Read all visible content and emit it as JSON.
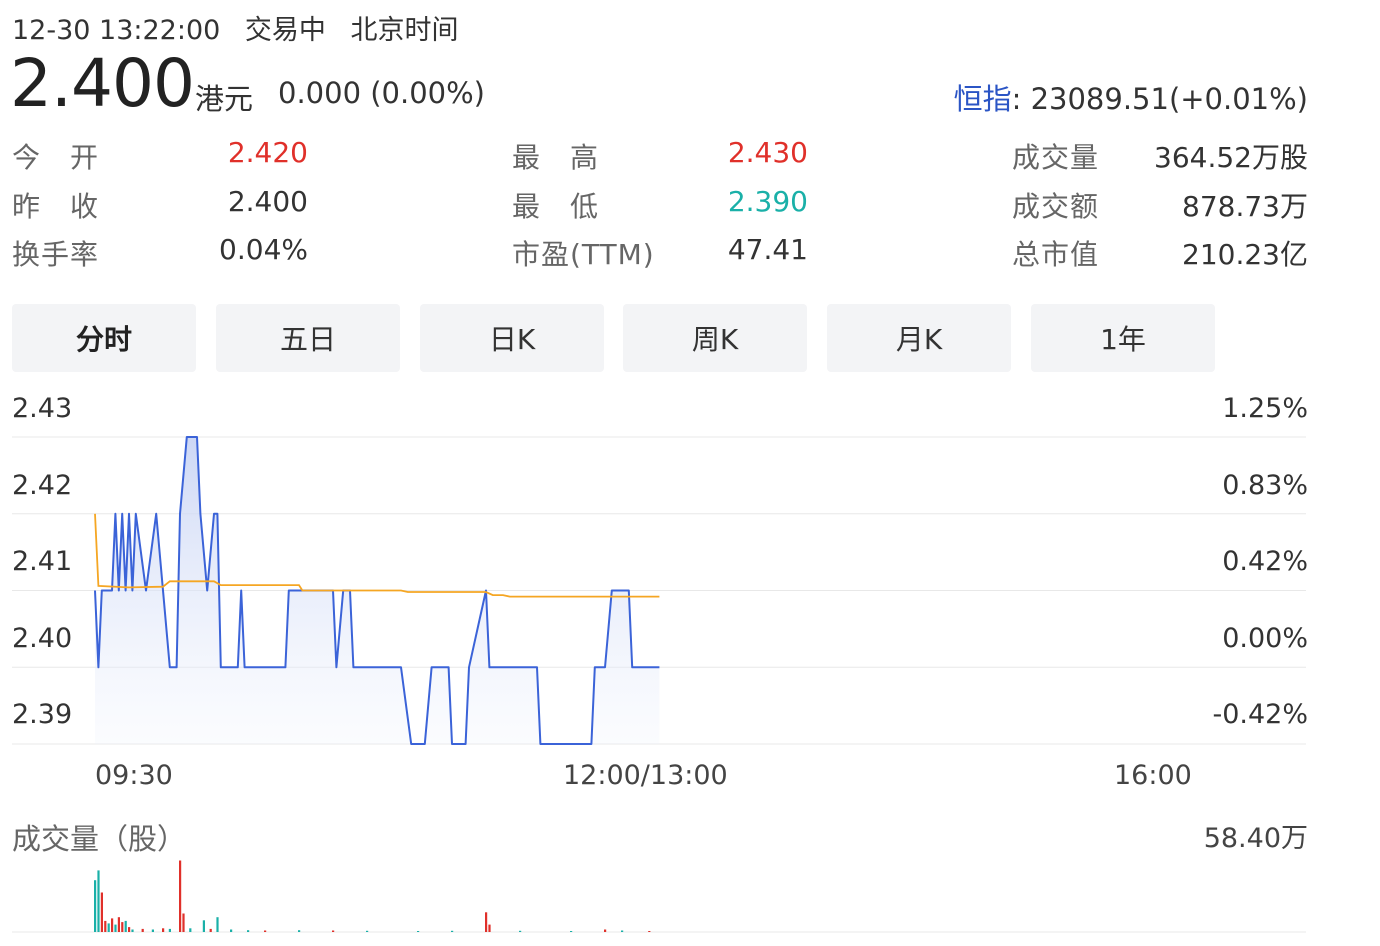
{
  "header": {
    "datetime": "12-30 13:22:00",
    "status": "交易中",
    "timezone": "北京时间",
    "price": "2.400",
    "currency": "港元",
    "change": "0.000 (0.00%)",
    "index_label": "恒指",
    "index_value": ": 23089.51(+0.01%)"
  },
  "stats": {
    "open_label": "今　开",
    "open_value": "2.420",
    "prev_close_label": "昨　收",
    "prev_close_value": "2.400",
    "turnover_rate_label": "换手率",
    "turnover_rate_value": "0.04%",
    "high_label": "最　高",
    "high_value": "2.430",
    "low_label": "最　低",
    "low_value": "2.390",
    "pe_label": "市盈(TTM)",
    "pe_value": "47.41",
    "volume_label": "成交量",
    "volume_value": "364.52万股",
    "amount_label": "成交额",
    "amount_value": "878.73万",
    "market_cap_label": "总市值",
    "market_cap_value": "210.23亿"
  },
  "tabs": [
    {
      "label": "分时",
      "active": true
    },
    {
      "label": "五日",
      "active": false
    },
    {
      "label": "日K",
      "active": false
    },
    {
      "label": "周K",
      "active": false
    },
    {
      "label": "月K",
      "active": false
    },
    {
      "label": "1年",
      "active": false
    }
  ],
  "colors": {
    "up": "#e0302a",
    "down": "#1ab0a8",
    "price_line": "#3b63d8",
    "avg_line": "#f5a623",
    "index_label": "#2b55c5"
  },
  "chart_data": [
    {
      "type": "line",
      "y_ticks_left": [
        "2.43",
        "2.42",
        "2.41",
        "2.40",
        "2.39"
      ],
      "y_ticks_right": [
        "1.25%",
        "0.83%",
        "0.42%",
        "0.00%",
        "-0.42%"
      ],
      "x_ticks": [
        "09:30",
        "12:00/13:00",
        "16:00"
      ],
      "ylim": [
        2.39,
        2.43
      ],
      "grid": true,
      "series": [
        {
          "role": "price",
          "points": [
            [
              0,
              2.41
            ],
            [
              1,
              2.4
            ],
            [
              2,
              2.41
            ],
            [
              5,
              2.41
            ],
            [
              6,
              2.42
            ],
            [
              7,
              2.41
            ],
            [
              8,
              2.42
            ],
            [
              9,
              2.41
            ],
            [
              10,
              2.42
            ],
            [
              11,
              2.41
            ],
            [
              12,
              2.42
            ],
            [
              15,
              2.41
            ],
            [
              18,
              2.42
            ],
            [
              20,
              2.41
            ],
            [
              22,
              2.4
            ],
            [
              24,
              2.4
            ],
            [
              25,
              2.42
            ],
            [
              27,
              2.43
            ],
            [
              30,
              2.43
            ],
            [
              31,
              2.42
            ],
            [
              33,
              2.41
            ],
            [
              35,
              2.42
            ],
            [
              36,
              2.42
            ],
            [
              37,
              2.4
            ],
            [
              42,
              2.4
            ],
            [
              43,
              2.41
            ],
            [
              44,
              2.4
            ],
            [
              56,
              2.4
            ],
            [
              57,
              2.41
            ],
            [
              70,
              2.41
            ],
            [
              71,
              2.4
            ],
            [
              73,
              2.41
            ],
            [
              75,
              2.41
            ],
            [
              76,
              2.4
            ],
            [
              90,
              2.4
            ],
            [
              93,
              2.39
            ],
            [
              97,
              2.39
            ],
            [
              99,
              2.4
            ],
            [
              104,
              2.4
            ],
            [
              105,
              2.39
            ],
            [
              109,
              2.39
            ],
            [
              110,
              2.4
            ],
            [
              115,
              2.41
            ],
            [
              116,
              2.4
            ],
            [
              130,
              2.4
            ],
            [
              131,
              2.39
            ],
            [
              146,
              2.39
            ],
            [
              147,
              2.4
            ],
            [
              150,
              2.4
            ],
            [
              152,
              2.41
            ],
            [
              157,
              2.41
            ],
            [
              158,
              2.4
            ],
            [
              166,
              2.4
            ]
          ]
        },
        {
          "role": "average",
          "points": [
            [
              0,
              2.42
            ],
            [
              1,
              2.4106
            ],
            [
              10,
              2.4104
            ],
            [
              20,
              2.4105
            ],
            [
              22,
              2.4112
            ],
            [
              35,
              2.4112
            ],
            [
              37,
              2.4107
            ],
            [
              60,
              2.4107
            ],
            [
              61,
              2.41
            ],
            [
              90,
              2.41
            ],
            [
              92,
              2.4098
            ],
            [
              115,
              2.4098
            ],
            [
              117,
              2.4094
            ],
            [
              120,
              2.4094
            ],
            [
              122,
              2.4092
            ],
            [
              166,
              2.4092
            ]
          ]
        }
      ]
    },
    {
      "type": "bar",
      "title": "成交量（股）",
      "max_label": "58.40万",
      "ylim": [
        0,
        584000
      ],
      "bars": [
        {
          "t": 0,
          "v": 420000,
          "dir": "down"
        },
        {
          "t": 1,
          "v": 500000,
          "dir": "down"
        },
        {
          "t": 2,
          "v": 320000,
          "dir": "up"
        },
        {
          "t": 3,
          "v": 90000,
          "dir": "up"
        },
        {
          "t": 4,
          "v": 70000,
          "dir": "down"
        },
        {
          "t": 5,
          "v": 110000,
          "dir": "up"
        },
        {
          "t": 6,
          "v": 60000,
          "dir": "down"
        },
        {
          "t": 7,
          "v": 120000,
          "dir": "up"
        },
        {
          "t": 8,
          "v": 80000,
          "dir": "up"
        },
        {
          "t": 9,
          "v": 90000,
          "dir": "down"
        },
        {
          "t": 10,
          "v": 40000,
          "dir": "up"
        },
        {
          "t": 11,
          "v": 20000,
          "dir": "down"
        },
        {
          "t": 14,
          "v": 25000,
          "dir": "up"
        },
        {
          "t": 17,
          "v": 20000,
          "dir": "down"
        },
        {
          "t": 20,
          "v": 30000,
          "dir": "up"
        },
        {
          "t": 22,
          "v": 25000,
          "dir": "down"
        },
        {
          "t": 25,
          "v": 580000,
          "dir": "up"
        },
        {
          "t": 26,
          "v": 150000,
          "dir": "up"
        },
        {
          "t": 28,
          "v": 30000,
          "dir": "down"
        },
        {
          "t": 32,
          "v": 95000,
          "dir": "down"
        },
        {
          "t": 34,
          "v": 25000,
          "dir": "up"
        },
        {
          "t": 36,
          "v": 120000,
          "dir": "down"
        },
        {
          "t": 40,
          "v": 20000,
          "dir": "down"
        },
        {
          "t": 45,
          "v": 15000,
          "dir": "down"
        },
        {
          "t": 50,
          "v": 12000,
          "dir": "up"
        },
        {
          "t": 60,
          "v": 15000,
          "dir": "down"
        },
        {
          "t": 70,
          "v": 12000,
          "dir": "up"
        },
        {
          "t": 80,
          "v": 10000,
          "dir": "down"
        },
        {
          "t": 95,
          "v": 8000,
          "dir": "down"
        },
        {
          "t": 105,
          "v": 10000,
          "dir": "down"
        },
        {
          "t": 115,
          "v": 160000,
          "dir": "up"
        },
        {
          "t": 116,
          "v": 60000,
          "dir": "up"
        },
        {
          "t": 125,
          "v": 10000,
          "dir": "down"
        },
        {
          "t": 140,
          "v": 8000,
          "dir": "down"
        },
        {
          "t": 150,
          "v": 20000,
          "dir": "up"
        },
        {
          "t": 155,
          "v": 12000,
          "dir": "down"
        },
        {
          "t": 163,
          "v": 8000,
          "dir": "up"
        }
      ]
    }
  ]
}
